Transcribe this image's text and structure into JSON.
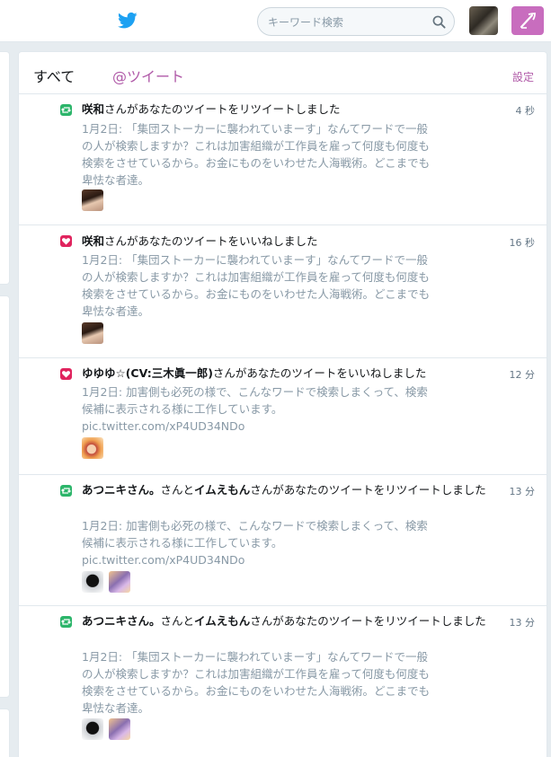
{
  "topbar": {
    "search_placeholder": "キーワード検索",
    "icons": {
      "logo": "twitter-bird-icon",
      "search": "search-icon",
      "compose": "compose-tweet-icon"
    },
    "brand_color": "#1da1f2",
    "accent_color": "#c86dbe"
  },
  "tabs": {
    "all": "すべて",
    "mentions": "@ツイート",
    "settings": "設定"
  },
  "notifications": [
    {
      "type": "retweet",
      "actor": "咲和",
      "mid": "",
      "actor2": "",
      "action": "さんがあなたのツイートをリツイートしました",
      "time": "4 秒",
      "text_lines": [
        "1月2日: 「集団ストーカーに襲われていまーす」なんてワードで一般",
        "の人が検索しますか？これは加害組織が工作員を雇って何度も何度も",
        "検索をさせているから。お金にものをいわせた人海戦術。どこまでも",
        "卑怯な者達。"
      ],
      "link": "",
      "avatars": 1
    },
    {
      "type": "like",
      "actor": "咲和",
      "mid": "",
      "actor2": "",
      "action": "さんがあなたのツイートをいいねしました",
      "time": "16 秒",
      "text_lines": [
        "1月2日: 「集団ストーカーに襲われていまーす」なんてワードで一般",
        "の人が検索しますか？これは加害組織が工作員を雇って何度も何度も",
        "検索をさせているから。お金にものをいわせた人海戦術。どこまでも",
        "卑怯な者達。"
      ],
      "link": "",
      "avatars": 1
    },
    {
      "type": "like",
      "actor": "ゆゆゆ☆(CV:三木眞一郎)",
      "mid": "",
      "actor2": "",
      "action": "さんがあなたのツイートをいいねしました",
      "time": "12 分",
      "text_lines": [
        "1月2日: 加害側も必死の様で、こんなワードで検索しまくって、検索",
        "候補に表示される様に工作しています。"
      ],
      "link": "pic.twitter.com/xP4UD34NDo",
      "avatars": 1
    },
    {
      "type": "retweet",
      "actor": "あつニキさん。",
      "mid": "さんと",
      "actor2": "イムえもん",
      "action": "さんがあなたのツイートをリツイートしました",
      "time": "13 分",
      "text_lines": [
        "1月2日: 加害側も必死の様で、こんなワードで検索しまくって、検索",
        "候補に表示される様に工作しています。"
      ],
      "link": "pic.twitter.com/xP4UD34NDo",
      "avatars": 2
    },
    {
      "type": "retweet",
      "actor": "あつニキさん。",
      "mid": "さんと",
      "actor2": "イムえもん",
      "action": "さんがあなたのツイートをリツイートしました",
      "time": "13 分",
      "text_lines": [
        "1月2日: 「集団ストーカーに襲われていまーす」なんてワードで一般",
        "の人が検索しますか？これは加害組織が工作員を雇って何度も何度も",
        "検索をさせているから。お金にものをいわせた人海戦術。どこまでも",
        "卑怯な者達。"
      ],
      "link": "",
      "avatars": 2
    }
  ]
}
